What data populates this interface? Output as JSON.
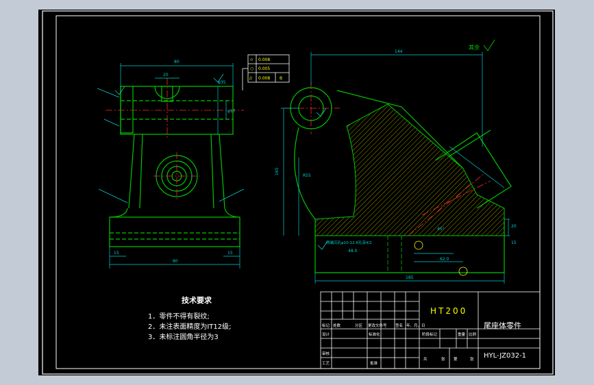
{
  "drawing": {
    "material": "HT200",
    "part_name": "尾座体零件",
    "drawing_number": "HYL-JZ032-1",
    "surface_note": "其余"
  },
  "tech_requirements": {
    "title": "技术要求",
    "items": [
      "1．零件不得有裂纹;",
      "2．未注表面精度为IT12级;",
      "3．未标注圆角半径为3"
    ]
  },
  "title_block": {
    "rev_headers": [
      "标记",
      "处数",
      "分区",
      "更改文件号",
      "签名",
      "年、月、日"
    ],
    "row_labels": [
      "设计",
      "审核",
      "工艺"
    ],
    "standardize": "标准化",
    "approve": "批准",
    "stage_headers": [
      "阶段标记",
      "重量",
      "比例"
    ],
    "sheet_info": [
      "共",
      "张",
      "第",
      "张"
    ]
  },
  "tolerance_frame": {
    "rows": [
      {
        "symbol": "⌭",
        "value": "0.008",
        "datum": ""
      },
      {
        "symbol": "○",
        "value": "0.005",
        "datum": ""
      },
      {
        "symbol": "//",
        "value": "0.008",
        "datum": "B"
      }
    ]
  },
  "dims": {
    "front_top_width": "80",
    "front_slot": "20",
    "front_bore": "φ17",
    "front_h1": "φ35",
    "front_base_width": "80",
    "front_left_foot": "15",
    "front_right_foot": "15",
    "side_total_width": "144",
    "side_height": "165",
    "side_base_length": "185",
    "side_r": "R55",
    "side_base_note": "两端沉孔φ10-12.8孔深4/2",
    "side_angle": "45°",
    "side_dim_62": "62.0",
    "side_dim_48": "48.0",
    "side_dim_20": "20",
    "side_dim_15": "15"
  },
  "colors": {
    "outline": "#00c800",
    "dim": "#00d0d0",
    "text": "#ffffff",
    "center": "#ff2a2a",
    "frame": "#ffffff",
    "hatch": "#d8d800",
    "material": "#ffff00"
  }
}
